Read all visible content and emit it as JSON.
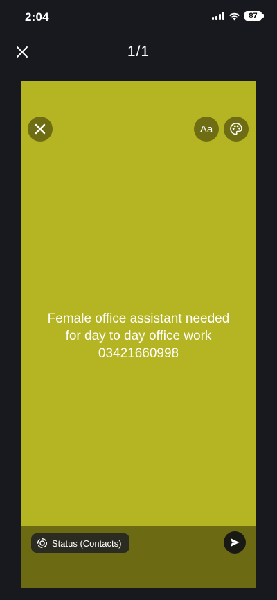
{
  "status_bar": {
    "time": "2:04",
    "battery": "87",
    "icons": [
      "signal-icon",
      "wifi-icon",
      "battery-icon"
    ]
  },
  "header": {
    "page_counter": "1/1",
    "close_icon": "close-icon"
  },
  "card": {
    "background_color": "#b5b523",
    "footer_color": "#6c6b14",
    "text_lines": [
      "Female office assistant needed",
      "for day to day office work",
      "03421660998"
    ],
    "toolbar": {
      "text_style_label": "Aa",
      "close_icon": "close-icon",
      "palette_icon": "palette-icon"
    },
    "audience_label": "Status (Contacts)",
    "audience_icon": "status-ring-icon",
    "send_icon": "send-icon"
  }
}
